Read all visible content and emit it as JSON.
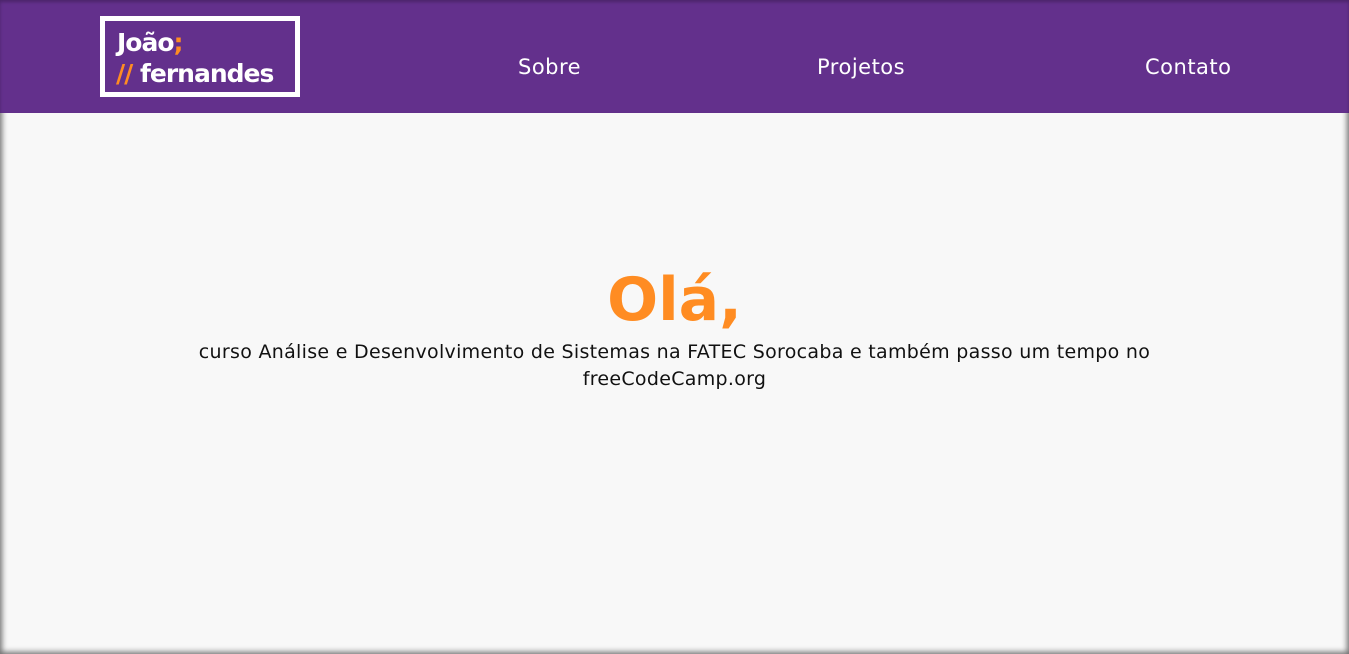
{
  "header": {
    "logo": {
      "first_name": "João",
      "first_suffix": ";",
      "prefix": "//",
      "last_name": "fernandes"
    },
    "nav": {
      "about": "Sobre",
      "projects": "Projetos",
      "contact": "Contato"
    }
  },
  "hero": {
    "greeting": "Olá,",
    "description": "curso Análise e Desenvolvimento de Sistemas na FATEC Sorocaba e também passo um tempo no freeCodeCamp.org"
  },
  "colors": {
    "brand_purple": "#63308c",
    "accent_orange": "#ff8c22",
    "background": "#f8f8f8"
  }
}
